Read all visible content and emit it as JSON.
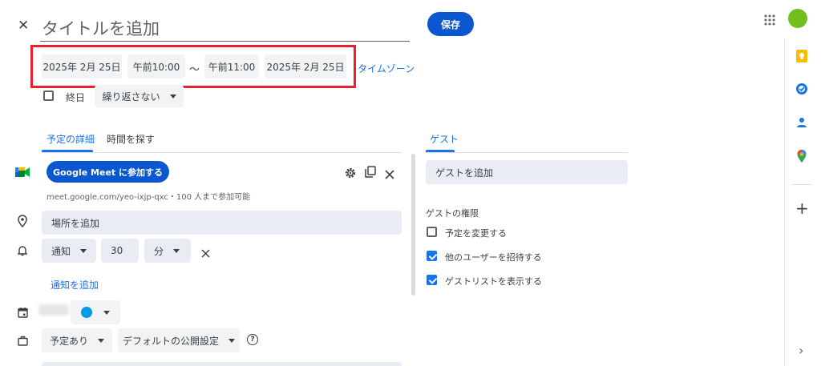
{
  "header": {
    "close_glyph": "✕",
    "title_placeholder": "タイトルを追加",
    "save_label": "保存"
  },
  "datetime": {
    "start_date": "2025年 2月 25日",
    "start_time": "午前10:00",
    "separator": "～",
    "end_time": "午前11:00",
    "end_date": "2025年 2月 25日",
    "timezone_link": "タイムゾーン",
    "highlight_color": "#e8202f"
  },
  "options": {
    "all_day_label": "終日",
    "all_day_checked": false,
    "repeat_label": "繰り返さない"
  },
  "tabs": [
    {
      "label": "予定の詳細",
      "active": true
    },
    {
      "label": "時間を探す",
      "active": false
    }
  ],
  "meet": {
    "button_label": "Google Meet に参加する",
    "info_text": "meet.google.com/yeo-ixjp-qxc・100 人まで参加可能"
  },
  "location": {
    "placeholder": "場所を追加"
  },
  "notification": {
    "type_label": "通知",
    "value": "30",
    "unit_label": "分",
    "add_link": "通知を追加"
  },
  "calendar": {
    "color": "#039be5"
  },
  "availability": {
    "busy_label": "予定あり",
    "visibility_label": "デフォルトの公開設定",
    "help_glyph": "?"
  },
  "guests": {
    "tab_label": "ゲスト",
    "add_placeholder": "ゲストを追加",
    "permissions_title": "ゲストの権限",
    "permissions": [
      {
        "label": "予定を変更する",
        "checked": false
      },
      {
        "label": "他のユーザーを招待する",
        "checked": true
      },
      {
        "label": "ゲストリストを表示する",
        "checked": true
      }
    ]
  },
  "side_rail": {
    "icons": [
      "keep-icon",
      "tasks-icon",
      "contacts-icon",
      "maps-icon"
    ],
    "add_glyph": "+",
    "chevron_glyph": "›"
  },
  "colors": {
    "accent": "#1a73e8",
    "primary_button": "#0b57d0",
    "avatar": "#6fbf1f"
  }
}
